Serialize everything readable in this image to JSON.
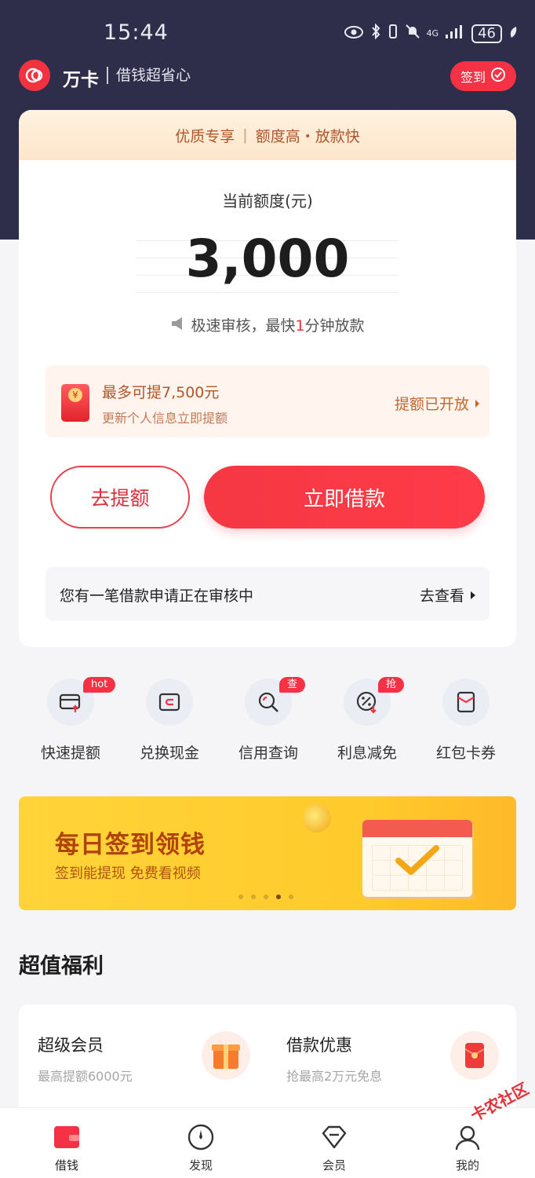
{
  "status_bar": {
    "time": "15:44",
    "network": "4G",
    "battery": "46"
  },
  "app_bar": {
    "brand": "万卡",
    "slogan": "借钱超省心",
    "checkin_label": "签到"
  },
  "main_card": {
    "banner_left": "优质专享",
    "banner_sep": "|",
    "banner_right": "额度高・放款快",
    "quota_label": "当前额度(元)",
    "quota_amount": "3,000",
    "tip_before": "极速审核，最快",
    "tip_highlight": "1",
    "tip_after": "分钟放款",
    "promo_title": "最多可提7,500元",
    "promo_sub": "更新个人信息立即提额",
    "promo_action": "提额已开放",
    "raise_button": "去提额",
    "borrow_button": "立即借款",
    "review_text": "您有一笔借款申请正在审核中",
    "review_link": "去查看"
  },
  "shortcuts": [
    {
      "label": "快速提额",
      "badge": "hot"
    },
    {
      "label": "兑换现金",
      "badge": ""
    },
    {
      "label": "信用查询",
      "badge": "查"
    },
    {
      "label": "利息减免",
      "badge": "抢"
    },
    {
      "label": "红包卡券",
      "badge": ""
    }
  ],
  "ad_banner": {
    "title": "每日签到领钱",
    "subtitle": "签到能提现 免费看视频",
    "dot_count": 5,
    "active_dot": 4
  },
  "welfare": {
    "section_title": "超值福利",
    "items": [
      {
        "title": "超级会员",
        "subtitle": "最高提额6000元"
      },
      {
        "title": "借款优惠",
        "subtitle": "抢最高2万元免息"
      }
    ]
  },
  "tab_bar": {
    "items": [
      {
        "label": "借钱"
      },
      {
        "label": "发现"
      },
      {
        "label": "会员"
      },
      {
        "label": "我的"
      }
    ]
  },
  "watermark": "卡农社区",
  "colors": {
    "header_bg": "#2f2e4a",
    "accent_red": "#f53145",
    "promo_text": "#b35627",
    "banner_yellow": "#ffd43a"
  }
}
